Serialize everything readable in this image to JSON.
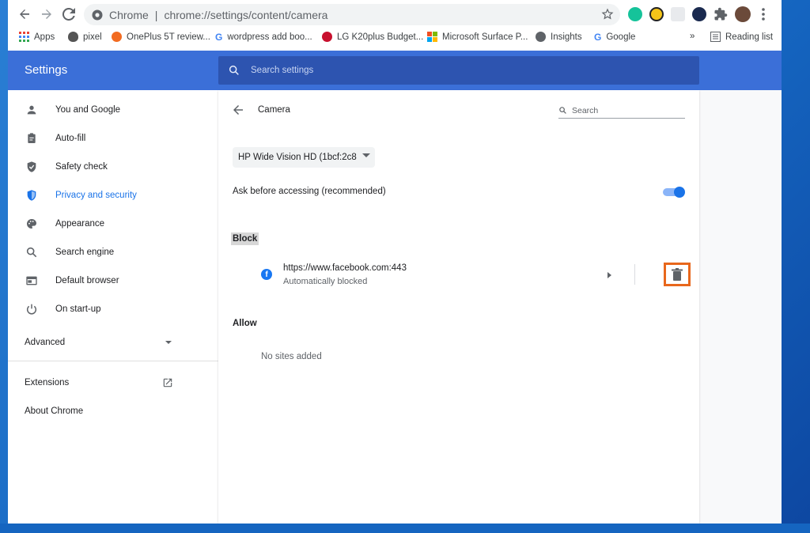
{
  "browser": {
    "omnibox": {
      "scheme": "Chrome",
      "url": "chrome://settings/content/camera"
    },
    "bookmarks": [
      {
        "label": "Apps",
        "icon": "apps-grid-icon"
      },
      {
        "label": "pixel",
        "icon": "apple-icon"
      },
      {
        "label": "OnePlus 5T review...",
        "icon": "oneplus-icon"
      },
      {
        "label": "wordpress add boo...",
        "icon": "google-icon"
      },
      {
        "label": "LG K20plus Budget...",
        "icon": "lg-icon"
      },
      {
        "label": "Microsoft Surface P...",
        "icon": "microsoft-icon"
      },
      {
        "label": "Insights",
        "icon": "globe-icon"
      },
      {
        "label": "Google",
        "icon": "google-icon"
      }
    ],
    "more": "»",
    "reading_list": "Reading list"
  },
  "settings": {
    "title": "Settings",
    "search_placeholder": "Search settings"
  },
  "sidebar": {
    "items": [
      {
        "label": "You and Google",
        "icon": "person-icon"
      },
      {
        "label": "Auto-fill",
        "icon": "clipboard-icon"
      },
      {
        "label": "Safety check",
        "icon": "shield-check-icon"
      },
      {
        "label": "Privacy and security",
        "icon": "shield-icon"
      },
      {
        "label": "Appearance",
        "icon": "palette-icon"
      },
      {
        "label": "Search engine",
        "icon": "search-icon"
      },
      {
        "label": "Default browser",
        "icon": "browser-icon"
      },
      {
        "label": "On start-up",
        "icon": "power-icon"
      }
    ],
    "advanced": "Advanced",
    "extensions": "Extensions",
    "about": "About Chrome"
  },
  "camera": {
    "title": "Camera",
    "search_placeholder": "Search",
    "device": "HP Wide Vision HD (1bcf:2c8",
    "ask_label": "Ask before accessing (recommended)",
    "ask_enabled": true,
    "block_label": "Block",
    "blocked_site": {
      "url": "https://www.facebook.com:443",
      "status": "Automatically blocked"
    },
    "allow_label": "Allow",
    "no_sites": "No sites added"
  },
  "colors": {
    "header": "#3b6fd8",
    "accent": "#1a73e8",
    "highlight": "#e8671c"
  }
}
